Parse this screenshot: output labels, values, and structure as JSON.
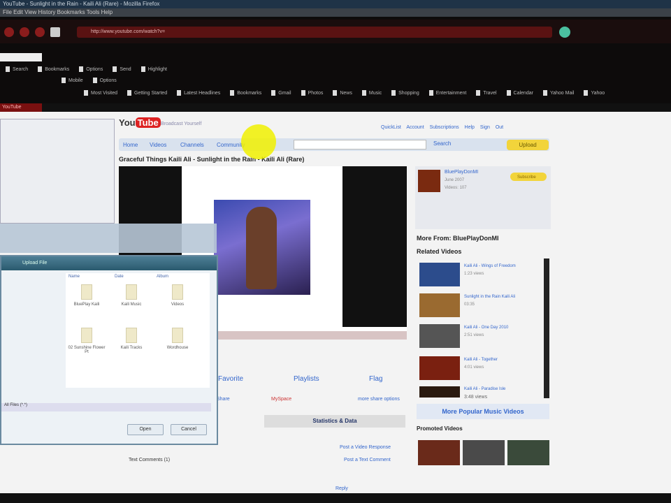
{
  "browser": {
    "title": "YouTube - Sunlight in the Rain - Kaili Ali (Rare) - Mozilla Firefox",
    "menu": "File  Edit  View  History  Bookmarks  Tools  Help",
    "url": "http://www.youtube.com/watch?v=",
    "tab": "YouTube",
    "toolbar1": [
      "",
      "",
      "",
      "",
      "",
      ""
    ],
    "toolbar2": [
      "Search",
      "",
      "",
      "",
      "Bookmarks",
      "",
      "Options",
      "",
      "Send",
      "",
      "Highlight"
    ],
    "toolbar3": [
      "Mobile",
      "Options"
    ],
    "bookmarks": [
      "Most Visited",
      "Getting Started",
      "Latest Headlines",
      "Bookmarks",
      "Gmail",
      "Photos",
      "News",
      "Music",
      "Shopping",
      "Entertainment",
      "Travel",
      "Calendar",
      "Yahoo Mail",
      "Yahoo"
    ]
  },
  "youtube": {
    "logo": "YouTube",
    "logo_tag": "Broadcast Yourself",
    "user_nav": "QuickList Account Subscriptions Help Sign Out",
    "nav": [
      "Home",
      "Videos",
      "Channels",
      "Community"
    ],
    "search_btn": "Search",
    "upload": "Upload",
    "video_title": "Graceful Things Kaili Ali - Sunlight in the Rain - Kaili Ali (Rare)",
    "actions": {
      "favorite": "Favorite",
      "playlists": "Playlists",
      "flag": "Flag"
    },
    "stats": "Statistics & Data",
    "share": "Share",
    "myspace": "MySpace",
    "more_share": "more share options",
    "responses": "Post a Video Response",
    "text_comments": "Text Comments (1)",
    "reply": "Reply",
    "post_comment": "Post a Text Comment",
    "sidebar": {
      "channel": "BluePlayDonMI",
      "joined": "June 2007",
      "videos": "Videos: 107",
      "subscribe": "Subscribe",
      "more_from": "More From: BluePlayDonMI",
      "related": "Related Videos",
      "related_items": [
        {
          "title": "Kaili Ali - Wings of Freedom",
          "meta": "1:23 views"
        },
        {
          "title": "Sunlight in the Rain Kaili Ali",
          "meta": "03:35"
        },
        {
          "title": "Kaili Ali - One Day 2010",
          "meta": "2:51 views"
        },
        {
          "title": "Kaili Ali - Together",
          "meta": "4:01 views"
        },
        {
          "title": "Kaili Ali - Paradise Isle",
          "meta": "3:48 views"
        }
      ],
      "more_popular": "More Popular Music Videos",
      "promoted": "Promoted Videos"
    }
  },
  "dialog": {
    "title": "Upload File",
    "open": "Open",
    "cancel": "Cancel",
    "columns": [
      "Name",
      "Date",
      "Album"
    ],
    "files": [
      "BluePlay Kaili",
      "Kaili Music",
      "Videos",
      "02 Sunshine Flower Pt",
      "Kaili Tracks",
      "Wordhouse"
    ],
    "filename_label": "All Files (*.*)"
  }
}
